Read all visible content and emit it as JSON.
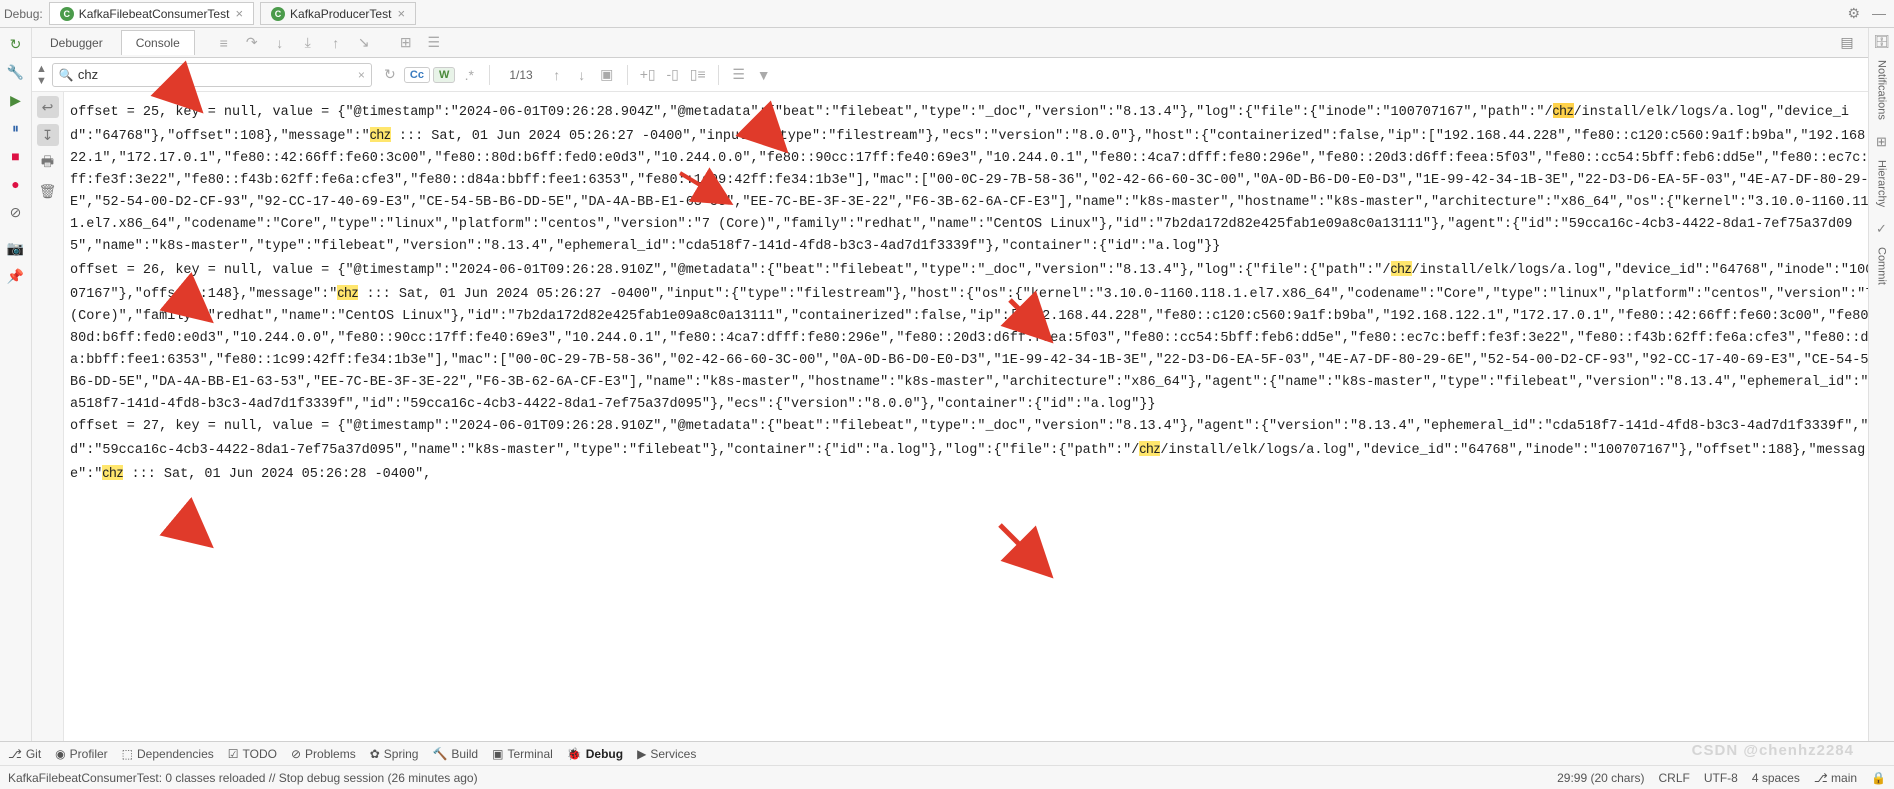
{
  "topbar": {
    "label": "Debug:",
    "tab1": "KafkaFilebeatConsumerTest",
    "tab2": "KafkaProducerTest"
  },
  "subtabs": {
    "debugger": "Debugger",
    "console": "Console"
  },
  "search": {
    "value": "chz",
    "cc": "Cc",
    "w": "W",
    "position": "1/13"
  },
  "console_text": "offset = 25, key = null, value = {\"@timestamp\":\"2024-06-01T09:26:28.904Z\",\"@metadata\":{\"beat\":\"filebeat\",\"type\":\"_doc\",\"version\":\"8.13.4\"},\"log\":{\"file\":{\"inode\":\"100707167\",\"path\":\"/||chz||/install/elk/logs/a.log\",\"device_id\":\"64768\"},\"offset\":108},\"message\":\"||chz|| ::: Sat, 01 Jun 2024 05:26:27 -0400\",\"input\":{\"type\":\"filestream\"},\"ecs\":\"version\":\"8.0.0\"},\"host\":{\"containerized\":false,\"ip\":[\"192.168.44.228\",\"fe80::c120:c560:9a1f:b9ba\",\"192.168.122.1\",\"172.17.0.1\",\"fe80::42:66ff:fe60:3c00\",\"fe80::80d:b6ff:fed0:e0d3\",\"10.244.0.0\",\"fe80::90cc:17ff:fe40:69e3\",\"10.244.0.1\",\"fe80::4ca7:dfff:fe80:296e\",\"fe80::20d3:d6ff:feea:5f03\",\"fe80::cc54:5bff:feb6:dd5e\",\"fe80::ec7c:beff:fe3f:3e22\",\"fe80::f43b:62ff:fe6a:cfe3\",\"fe80::d84a:bbff:fee1:6353\",\"fe80::1c99:42ff:fe34:1b3e\"],\"mac\":[\"00-0C-29-7B-58-36\",\"02-42-66-60-3C-00\",\"0A-0D-B6-D0-E0-D3\",\"1E-99-42-34-1B-3E\",\"22-D3-D6-EA-5F-03\",\"4E-A7-DF-80-29-6E\",\"52-54-00-D2-CF-93\",\"92-CC-17-40-69-E3\",\"CE-54-5B-B6-DD-5E\",\"DA-4A-BB-E1-63-53\",\"EE-7C-BE-3F-3E-22\",\"F6-3B-62-6A-CF-E3\"],\"name\":\"k8s-master\",\"hostname\":\"k8s-master\",\"architecture\":\"x86_64\",\"os\":{\"kernel\":\"3.10.0-1160.118.1.el7.x86_64\",\"codename\":\"Core\",\"type\":\"linux\",\"platform\":\"centos\",\"version\":\"7 (Core)\",\"family\":\"redhat\",\"name\":\"CentOS Linux\"},\"id\":\"7b2da172d82e425fab1e09a8c0a13111\"},\"agent\":{\"id\":\"59cca16c-4cb3-4422-8da1-7ef75a37d095\",\"name\":\"k8s-master\",\"type\":\"filebeat\",\"version\":\"8.13.4\",\"ephemeral_id\":\"cda518f7-141d-4fd8-b3c3-4ad7d1f3339f\"},\"container\":{\"id\":\"a.log\"}}\noffset = 26, key = null, value = {\"@timestamp\":\"2024-06-01T09:26:28.910Z\",\"@metadata\":{\"beat\":\"filebeat\",\"type\":\"_doc\",\"version\":\"8.13.4\"},\"log\":{\"file\":{\"path\":\"/||chz||/install/elk/logs/a.log\",\"device_id\":\"64768\",\"inode\":\"100707167\"},\"offset\":148},\"message\":\"||chz|| ::: Sat, 01 Jun 2024 05:26:27 -0400\",\"input\":{\"type\":\"filestream\"},\"host\":{\"os\":{\"kernel\":\"3.10.0-1160.118.1.el7.x86_64\",\"codename\":\"Core\",\"type\":\"linux\",\"platform\":\"centos\",\"version\":\"7 (Core)\",\"family\":\"redhat\",\"name\":\"CentOS Linux\"},\"id\":\"7b2da172d82e425fab1e09a8c0a13111\",\"containerized\":false,\"ip\":[\"192.168.44.228\",\"fe80::c120:c560:9a1f:b9ba\",\"192.168.122.1\",\"172.17.0.1\",\"fe80::42:66ff:fe60:3c00\",\"fe80::80d:b6ff:fed0:e0d3\",\"10.244.0.0\",\"fe80::90cc:17ff:fe40:69e3\",\"10.244.0.1\",\"fe80::4ca7:dfff:fe80:296e\",\"fe80::20d3:d6ff:feea:5f03\",\"fe80::cc54:5bff:feb6:dd5e\",\"fe80::ec7c:beff:fe3f:3e22\",\"fe80::f43b:62ff:fe6a:cfe3\",\"fe80::d84a:bbff:fee1:6353\",\"fe80::1c99:42ff:fe34:1b3e\"],\"mac\":[\"00-0C-29-7B-58-36\",\"02-42-66-60-3C-00\",\"0A-0D-B6-D0-E0-D3\",\"1E-99-42-34-1B-3E\",\"22-D3-D6-EA-5F-03\",\"4E-A7-DF-80-29-6E\",\"52-54-00-D2-CF-93\",\"92-CC-17-40-69-E3\",\"CE-54-5B-B6-DD-5E\",\"DA-4A-BB-E1-63-53\",\"EE-7C-BE-3F-3E-22\",\"F6-3B-62-6A-CF-E3\"],\"name\":\"k8s-master\",\"hostname\":\"k8s-master\",\"architecture\":\"x86_64\"},\"agent\":{\"name\":\"k8s-master\",\"type\":\"filebeat\",\"version\":\"8.13.4\",\"ephemeral_id\":\"cda518f7-141d-4fd8-b3c3-4ad7d1f3339f\",\"id\":\"59cca16c-4cb3-4422-8da1-7ef75a37d095\"},\"ecs\":{\"version\":\"8.0.0\"},\"container\":{\"id\":\"a.log\"}}\noffset = 27, key = null, value = {\"@timestamp\":\"2024-06-01T09:26:28.910Z\",\"@metadata\":{\"beat\":\"filebeat\",\"type\":\"_doc\",\"version\":\"8.13.4\"},\"agent\":{\"version\":\"8.13.4\",\"ephemeral_id\":\"cda518f7-141d-4fd8-b3c3-4ad7d1f3339f\",\"id\":\"59cca16c-4cb3-4422-8da1-7ef75a37d095\",\"name\":\"k8s-master\",\"type\":\"filebeat\"},\"container\":{\"id\":\"a.log\"},\"log\":{\"file\":{\"path\":\"/||chz||/install/elk/logs/a.log\",\"device_id\":\"64768\",\"inode\":\"100707167\"},\"offset\":188},\"message\":\"||chz|| ::: Sat, 01 Jun 2024 05:26:28 -0400\",",
  "bottom": {
    "git": "Git",
    "profiler": "Profiler",
    "dependencies": "Dependencies",
    "todo": "TODO",
    "problems": "Problems",
    "spring": "Spring",
    "build": "Build",
    "terminal": "Terminal",
    "debug": "Debug",
    "services": "Services"
  },
  "status": {
    "left": "KafkaFilebeatConsumerTest: 0 classes reloaded // Stop debug session (26 minutes ago)",
    "pos": "29:99 (20 chars)",
    "sep": "CRLF",
    "enc": "UTF-8",
    "indent": "4 spaces",
    "branch": "main"
  },
  "rail": {
    "notifications": "Notifications",
    "hierarchy": "Hierarchy",
    "commit": "Commit"
  },
  "watermark": "CSDN @chenhz2284"
}
